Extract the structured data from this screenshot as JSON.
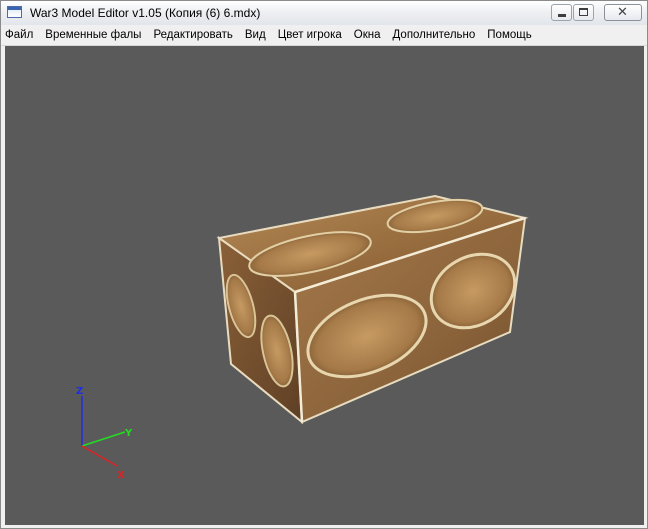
{
  "window": {
    "title": "War3 Model Editor v1.05 (Копия (6) 6.mdx)",
    "icon": "app-window-icon",
    "controls": {
      "minimize_icon": "minimize-icon",
      "maximize_icon": "maximize-icon",
      "close_icon": "close-icon",
      "close_glyph": "✕"
    }
  },
  "menu": {
    "items": [
      {
        "label": "Файл"
      },
      {
        "label": "Временные фалы"
      },
      {
        "label": "Редактировать"
      },
      {
        "label": "Вид"
      },
      {
        "label": "Цвет игрока"
      },
      {
        "label": "Окна"
      },
      {
        "label": "Дополнительно"
      },
      {
        "label": "Помощь"
      }
    ]
  },
  "viewport": {
    "background_color": "#5a5a5a",
    "model": "textured-wooden-crate",
    "axes": {
      "z": {
        "label": "Z",
        "color": "#1f2ee0"
      },
      "y": {
        "label": "Y",
        "color": "#22dd22"
      },
      "x": {
        "label": "X",
        "color": "#dd2222"
      }
    }
  }
}
